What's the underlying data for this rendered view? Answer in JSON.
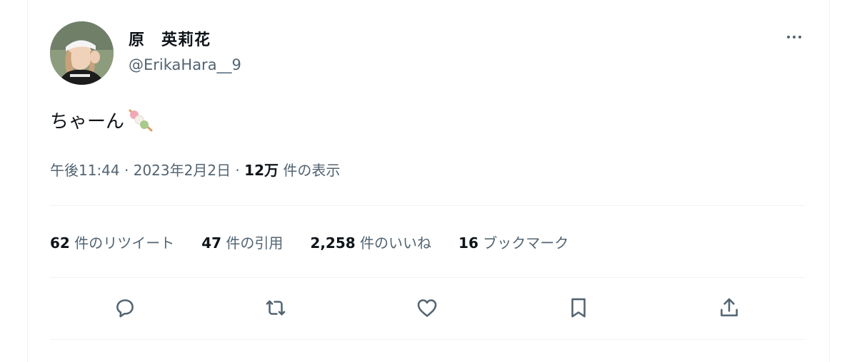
{
  "user": {
    "display_name": "原　英莉花",
    "handle": "@ErikaHara__9"
  },
  "tweet": {
    "text": "ちゃーん",
    "emoji_icon": "dango-icon"
  },
  "meta": {
    "time": "午後11:44",
    "separator": " · ",
    "date": "2023年2月2日",
    "views_count": "12万",
    "views_label": " 件の表示"
  },
  "stats": [
    {
      "count": "62",
      "label": " 件のリツイート"
    },
    {
      "count": "47",
      "label": " 件の引用"
    },
    {
      "count": "2,258",
      "label": " 件のいいね"
    },
    {
      "count": "16",
      "label": " ブックマーク"
    }
  ],
  "actions": [
    "reply-icon",
    "retweet-icon",
    "like-icon",
    "bookmark-icon",
    "share-icon"
  ],
  "colors": {
    "text": "#0f1419",
    "secondary": "#536471",
    "divider": "#eff3f4"
  }
}
